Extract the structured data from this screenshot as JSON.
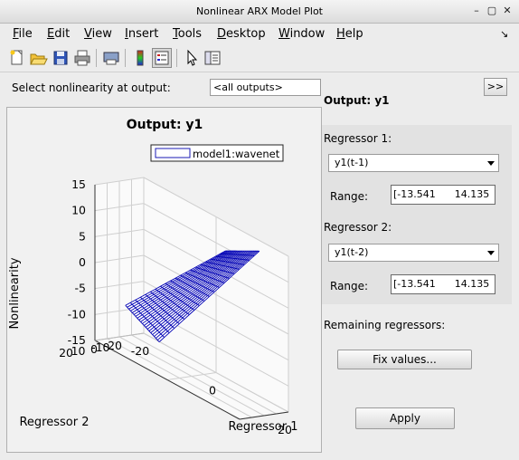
{
  "window": {
    "title": "Nonlinear ARX Model Plot",
    "controls": [
      "minimize-icon",
      "maximize-icon",
      "close-icon"
    ]
  },
  "menu": [
    {
      "mnemonic": "F",
      "rest": "ile"
    },
    {
      "mnemonic": "E",
      "rest": "dit"
    },
    {
      "mnemonic": "V",
      "rest": "iew"
    },
    {
      "mnemonic": "I",
      "rest": "nsert"
    },
    {
      "mnemonic": "T",
      "rest": "ools"
    },
    {
      "mnemonic": "D",
      "rest": "esktop"
    },
    {
      "mnemonic": "W",
      "rest": "indow"
    },
    {
      "mnemonic": "H",
      "rest": "elp"
    }
  ],
  "toolbar": {
    "icons": [
      "new-figure-icon",
      "open-file-icon",
      "save-icon",
      "print-icon",
      "print-preview-icon",
      "colorbar-icon",
      "legend-icon",
      "pointer-icon",
      "property-editor-icon"
    ],
    "active": "legend-icon"
  },
  "output_select": {
    "label": "Select nonlinearity at output:",
    "value": "<all outputs>"
  },
  "expand_button": ">>",
  "right_panel": {
    "title": "Output: y1",
    "regressor1": {
      "label": "Regressor 1:",
      "value": "y1(t-1)",
      "range_label": "Range:",
      "range_value": "[-13.541      14.135"
    },
    "regressor2": {
      "label": "Regressor 2:",
      "value": "y1(t-2)",
      "range_label": "Range:",
      "range_value": "[-13.541      14.135"
    },
    "remaining_label": "Remaining regressors:",
    "fix_button": "Fix values...",
    "apply_button": "Apply"
  },
  "chart_data": {
    "type": "surface",
    "title": "Output: y1",
    "xlabel": "Regressor 1",
    "ylabel": "Regressor 2",
    "zlabel": "Nonlinearity",
    "legend": [
      "model1:wavenet"
    ],
    "x_ticks": [
      -20,
      0,
      20
    ],
    "y_ticks": [
      -20,
      -10,
      0,
      10,
      20
    ],
    "z_ticks": [
      -15,
      -10,
      -5,
      0,
      5,
      10,
      15
    ],
    "xlim": [
      -13.541,
      14.135
    ],
    "ylim": [
      -13.541,
      14.135
    ],
    "zlim": [
      -15,
      15
    ],
    "series_color": "#0000b4",
    "surface": {
      "grid_x": 20,
      "grid_y": 20,
      "z_at_corners": {
        "xmin_ymin": -14,
        "xmax_ymin": 14,
        "xmin_ymax": -6,
        "xmax_ymax": 15
      }
    }
  }
}
